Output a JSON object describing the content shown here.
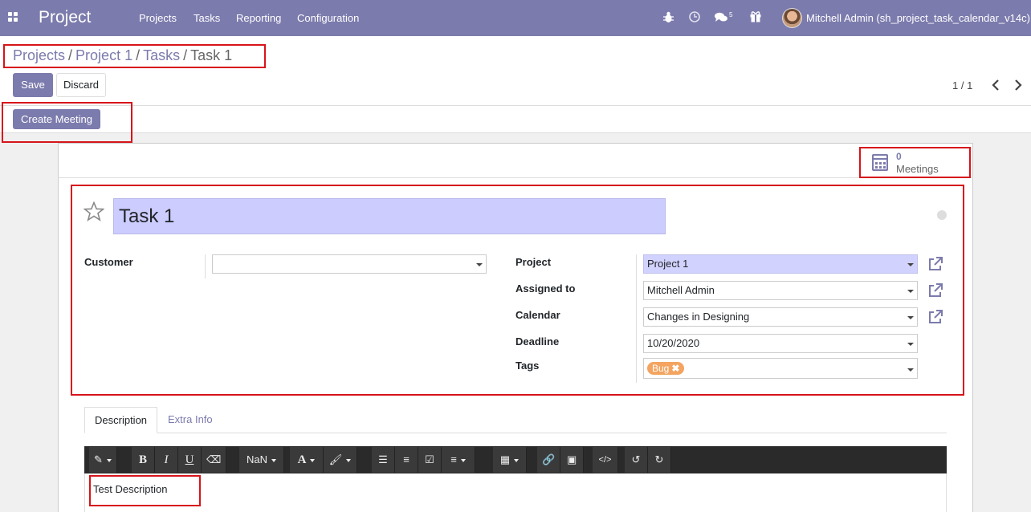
{
  "navbar": {
    "brand": "Project",
    "menu": [
      "Projects",
      "Tasks",
      "Reporting",
      "Configuration"
    ],
    "chat_count": "5",
    "user_name": "Mitchell Admin (sh_project_task_calendar_v14c)",
    "icons": [
      "apps-icon",
      "bug-icon",
      "clock-icon",
      "chat-icon",
      "gift-icon"
    ]
  },
  "breadcrumb": {
    "items": [
      "Projects",
      "Project 1",
      "Tasks"
    ],
    "current": "Task 1",
    "separator": "/"
  },
  "actions": {
    "save": "Save",
    "discard": "Discard"
  },
  "pager": {
    "value": "1 / 1"
  },
  "header": {
    "create_meeting": "Create Meeting"
  },
  "smart_button": {
    "count": "0",
    "label": "Meetings"
  },
  "task": {
    "title": "Task 1",
    "fields": {
      "customer": {
        "label": "Customer",
        "value": ""
      },
      "project": {
        "label": "Project",
        "value": "Project 1"
      },
      "assigned_to": {
        "label": "Assigned to",
        "value": "Mitchell Admin"
      },
      "calendar": {
        "label": "Calendar",
        "value": "Changes in Designing"
      },
      "deadline": {
        "label": "Deadline",
        "value": "10/20/2020"
      },
      "tags": {
        "label": "Tags",
        "values": [
          "Bug"
        ]
      }
    }
  },
  "tabs": {
    "description": "Description",
    "extra_info": "Extra Info"
  },
  "editor": {
    "font_size": "NaN",
    "content": "Test Description"
  },
  "colors": {
    "primary": "#7c7bad",
    "required_field": "#d2d2ff",
    "highlight": "#d7141a",
    "tag_bug": "#f4a460"
  }
}
